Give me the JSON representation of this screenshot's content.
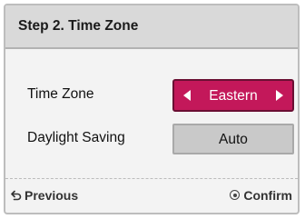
{
  "header": {
    "title": "Step 2. Time Zone"
  },
  "settings": {
    "time_zone": {
      "label": "Time Zone",
      "value": "Eastern"
    },
    "daylight_saving": {
      "label": "Daylight Saving",
      "value": "Auto"
    }
  },
  "footer": {
    "previous_label": "Previous",
    "confirm_label": "Confirm",
    "previous_icon": "back-arrow-icon",
    "confirm_icon": "ok-button-icon"
  },
  "colors": {
    "accent": "#c3185a",
    "header_bg": "#d9d9d9",
    "panel_bg": "#f3f3f3"
  }
}
